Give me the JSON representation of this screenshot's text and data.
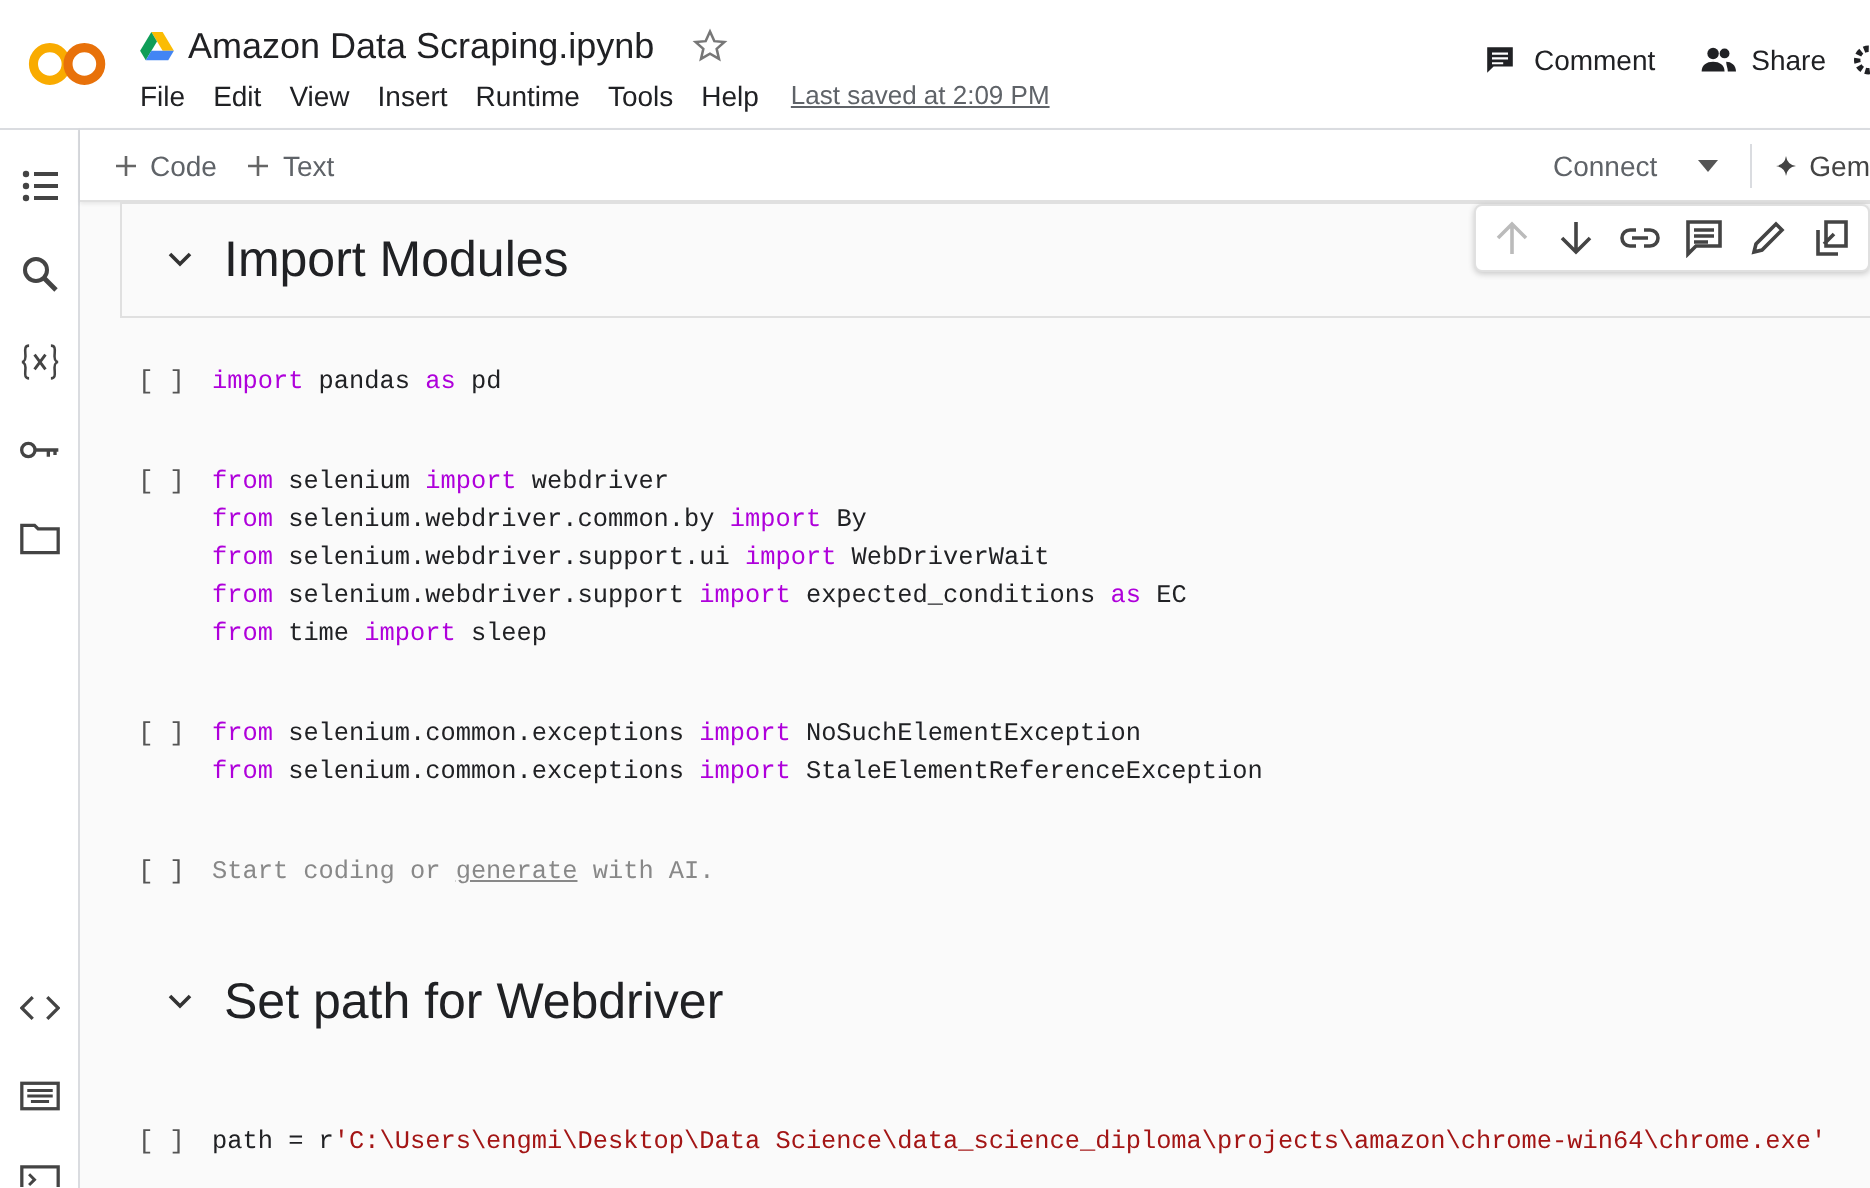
{
  "header": {
    "title": "Amazon Data Scraping.ipynb",
    "starred": false,
    "menu": [
      "File",
      "Edit",
      "View",
      "Insert",
      "Runtime",
      "Tools",
      "Help"
    ],
    "last_saved": "Last saved at 2:09 PM",
    "actions": [
      {
        "kind": "comment",
        "label": "Comment"
      },
      {
        "kind": "share",
        "label": "Share"
      }
    ]
  },
  "toolbar": {
    "add": [
      "Code",
      "Text"
    ],
    "connect": "Connect",
    "gemini": "Gem"
  },
  "sidebar": {
    "top": [
      {
        "kind": "list"
      },
      {
        "kind": "search"
      },
      {
        "kind": "variables"
      },
      {
        "kind": "key"
      },
      {
        "kind": "folder"
      }
    ],
    "bottom": [
      {
        "kind": "code"
      },
      {
        "kind": "keyboard"
      },
      {
        "kind": "terminal"
      }
    ]
  },
  "cell_toolbar": [
    {
      "kind": "up",
      "disabled": true
    },
    {
      "kind": "down",
      "disabled": false
    },
    {
      "kind": "link",
      "disabled": false
    },
    {
      "kind": "comment",
      "disabled": false
    },
    {
      "kind": "edit",
      "disabled": false
    },
    {
      "kind": "mirror",
      "disabled": false
    }
  ],
  "cells": [
    {
      "kind": "heading",
      "text": "Import Modules",
      "expanded": true,
      "selected": true
    },
    {
      "kind": "code",
      "prompt": "[ ]",
      "lines": [
        [
          {
            "t": "import",
            "kind": "kw"
          },
          {
            "t": " pandas ",
            "kind": "plain"
          },
          {
            "t": "as",
            "kind": "kw"
          },
          {
            "t": " pd",
            "kind": "plain"
          }
        ]
      ]
    },
    {
      "kind": "code",
      "prompt": "[ ]",
      "lines": [
        [
          {
            "t": "from",
            "kind": "kw"
          },
          {
            "t": " selenium ",
            "kind": "plain"
          },
          {
            "t": "import",
            "kind": "kw"
          },
          {
            "t": " webdriver",
            "kind": "plain"
          }
        ],
        [
          {
            "t": "from",
            "kind": "kw"
          },
          {
            "t": " selenium.webdriver.common.by ",
            "kind": "plain"
          },
          {
            "t": "import",
            "kind": "kw"
          },
          {
            "t": " By",
            "kind": "plain"
          }
        ],
        [
          {
            "t": "from",
            "kind": "kw"
          },
          {
            "t": " selenium.webdriver.support.ui ",
            "kind": "plain"
          },
          {
            "t": "import",
            "kind": "kw"
          },
          {
            "t": " WebDriverWait",
            "kind": "plain"
          }
        ],
        [
          {
            "t": "from",
            "kind": "kw"
          },
          {
            "t": " selenium.webdriver.support ",
            "kind": "plain"
          },
          {
            "t": "import",
            "kind": "kw"
          },
          {
            "t": " expected_conditions ",
            "kind": "plain"
          },
          {
            "t": "as",
            "kind": "kw"
          },
          {
            "t": " EC",
            "kind": "plain"
          }
        ],
        [
          {
            "t": "from",
            "kind": "kw"
          },
          {
            "t": " time ",
            "kind": "plain"
          },
          {
            "t": "import",
            "kind": "kw"
          },
          {
            "t": " sleep",
            "kind": "plain"
          }
        ]
      ]
    },
    {
      "kind": "code",
      "prompt": "[ ]",
      "lines": [
        [
          {
            "t": "from",
            "kind": "kw"
          },
          {
            "t": " selenium.common.exceptions ",
            "kind": "plain"
          },
          {
            "t": "import",
            "kind": "kw"
          },
          {
            "t": " NoSuchElementException",
            "kind": "plain"
          }
        ],
        [
          {
            "t": "from",
            "kind": "kw"
          },
          {
            "t": " selenium.common.exceptions ",
            "kind": "plain"
          },
          {
            "t": "import",
            "kind": "kw"
          },
          {
            "t": " StaleElementReferenceException",
            "kind": "plain"
          }
        ]
      ]
    },
    {
      "kind": "empty",
      "prompt": "[ ]",
      "before": "Start coding or",
      "link": "generate",
      "after": "with AI."
    },
    {
      "kind": "heading",
      "text": "Set path for Webdriver",
      "expanded": true,
      "selected": false
    },
    {
      "kind": "code",
      "prompt": "[ ]",
      "lines": [
        [
          {
            "t": "path = r",
            "kind": "plain"
          },
          {
            "t": "'C:\\Users\\engmi\\Desktop\\Data Science\\data_science_diploma\\projects\\amazon\\chrome-win64\\chrome.exe'",
            "kind": "str"
          }
        ]
      ]
    }
  ]
}
